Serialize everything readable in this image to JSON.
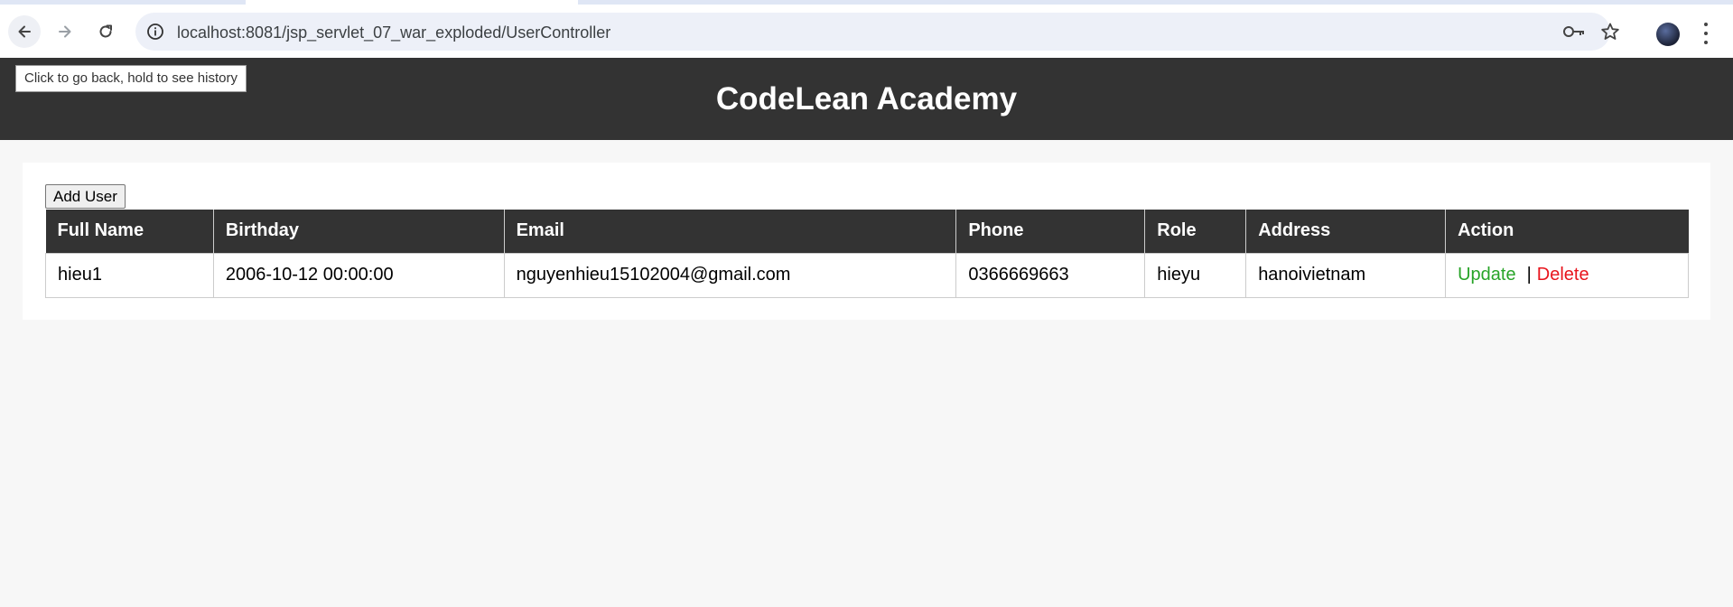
{
  "browser": {
    "url": "localhost:8081/jsp_servlet_07_war_exploded/UserController",
    "tooltip": "Click to go back, hold to see history",
    "icons": [
      "back-arrow-icon",
      "forward-arrow-icon",
      "reload-icon",
      "info-icon",
      "key-icon",
      "star-icon",
      "profile-avatar",
      "menu-dots-icon"
    ]
  },
  "header": {
    "title": "CodeLean Academy"
  },
  "main": {
    "add_button": "Add User",
    "columns": [
      "Full Name",
      "Birthday",
      "Email",
      "Phone",
      "Role",
      "Address",
      "Action"
    ],
    "rows": [
      {
        "full_name": "hieu1",
        "birthday": "2006-10-12 00:00:00",
        "email": "nguyenhieu15102004@gmail.com",
        "phone": "0366669663",
        "role": "hieyu",
        "address": "hanoivietnam",
        "update_label": "Update",
        "separator": "|",
        "delete_label": "Delete"
      }
    ]
  },
  "colors": {
    "header_bg": "#333333",
    "update_link": "#28a428",
    "delete_link": "#e8141c",
    "page_bg": "#f7f7f7"
  }
}
